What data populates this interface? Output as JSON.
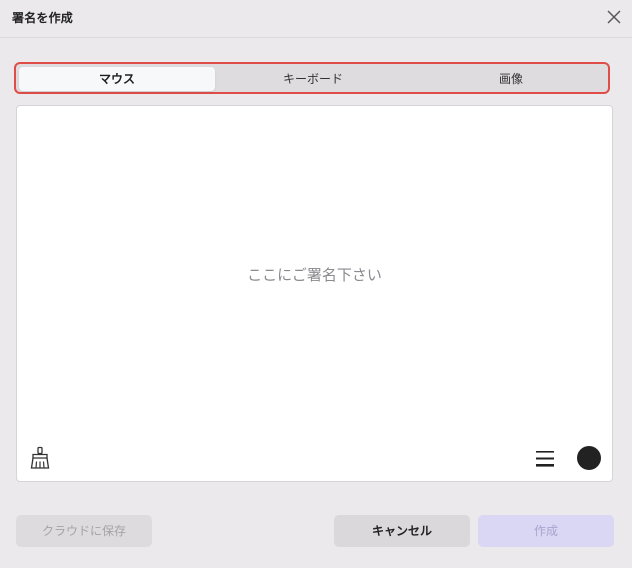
{
  "dialog": {
    "title": "署名を作成"
  },
  "tabs": [
    {
      "label": "マウス",
      "active": true
    },
    {
      "label": "キーボード",
      "active": false
    },
    {
      "label": "画像",
      "active": false
    }
  ],
  "canvas": {
    "placeholder": "ここにご署名下さい",
    "pen_color": "#222222"
  },
  "buttons": {
    "save_cloud": "クラウドに保存",
    "cancel": "キャンセル",
    "create": "作成"
  },
  "colors": {
    "tab_highlight_border": "#e04d49",
    "background": "#ebe9ec",
    "create_disabled": "#d9d7f3"
  }
}
